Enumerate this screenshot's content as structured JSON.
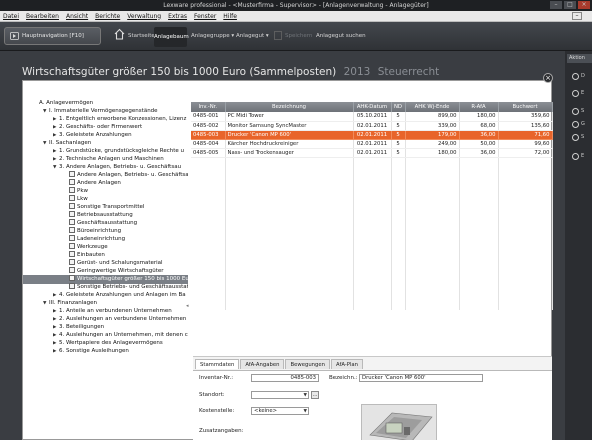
{
  "window": {
    "title": "Lexware professional - <Musterfirma - Supervisor> - [Anlagenverwaltung - Anlagegüter]",
    "controls": [
      "–",
      "□",
      "×"
    ]
  },
  "menu": [
    "Datei",
    "Bearbeiten",
    "Ansicht",
    "Berichte",
    "Verwaltung",
    "Extras",
    "Fenster",
    "Hilfe"
  ],
  "menu_min": "–",
  "toolbar": {
    "hauptnavigation": "Hauptnavigation [F10]",
    "startseite": "Startseite",
    "anlagebaum": "Anlagebaum",
    "anlagegruppe": "Anlagegruppe",
    "anlagegut": "Anlagegut",
    "speichern": "Speichern",
    "anlagegut_suchen": "Anlagegut suchen"
  },
  "page": {
    "title": "Wirtschaftsgüter größer 150 bis 1000 Euro (Sammelposten)",
    "year": "2013",
    "law": "Steuerrecht"
  },
  "tree": [
    {
      "label": "A. Anlagevermögen",
      "level": 0,
      "arrow": ""
    },
    {
      "label": "I. Immaterielle Vermögensgegenstände",
      "level": 1,
      "arrow": "▼"
    },
    {
      "label": "1. Entgeltlich erworbene Konzessionen, Lizenz",
      "level": 2,
      "arrow": "▶"
    },
    {
      "label": "2. Geschäfts- oder Firmenwert",
      "level": 2,
      "arrow": "▶"
    },
    {
      "label": "3. Geleistete Anzahlungen",
      "level": 2,
      "arrow": "▶"
    },
    {
      "label": "II. Sachanlagen",
      "level": 1,
      "arrow": "▼"
    },
    {
      "label": "1. Grundstücke, grundstücksgleiche Rechte u",
      "level": 2,
      "arrow": "▶"
    },
    {
      "label": "2. Technische Anlagen und Maschinen",
      "level": 2,
      "arrow": "▶"
    },
    {
      "label": "3. Andere Anlagen, Betriebs- u. Geschäftsau",
      "level": 2,
      "arrow": "▼"
    },
    {
      "label": "Andere Anlagen, Betriebs- u. Geschäftsau",
      "level": 3,
      "arrow": ""
    },
    {
      "label": "Andere Anlagen",
      "level": 3,
      "arrow": ""
    },
    {
      "label": "Pkw",
      "level": 3,
      "arrow": ""
    },
    {
      "label": "Lkw",
      "level": 3,
      "arrow": ""
    },
    {
      "label": "Sonstige Transportmittel",
      "level": 3,
      "arrow": ""
    },
    {
      "label": "Betriebsausstattung",
      "level": 3,
      "arrow": ""
    },
    {
      "label": "Geschäftsausstattung",
      "level": 3,
      "arrow": ""
    },
    {
      "label": "Büroeinrichtung",
      "level": 3,
      "arrow": ""
    },
    {
      "label": "Ladeneinrichtung",
      "level": 3,
      "arrow": ""
    },
    {
      "label": "Werkzeuge",
      "level": 3,
      "arrow": ""
    },
    {
      "label": "Einbauten",
      "level": 3,
      "arrow": ""
    },
    {
      "label": "Gerüst- und Schalungsmaterial",
      "level": 3,
      "arrow": ""
    },
    {
      "label": "Geringwertige Wirtschaftsgüter",
      "level": 3,
      "arrow": ""
    },
    {
      "label": "Wirtschaftsgüter größer 150 bis 1000 Euro",
      "level": 3,
      "arrow": "",
      "selected": true
    },
    {
      "label": "Sonstige Betriebs- und Geschäftsausstatt",
      "level": 3,
      "arrow": ""
    },
    {
      "label": "4. Geleistete Anzahlungen und Anlagen im Ba",
      "level": 2,
      "arrow": "▶"
    },
    {
      "label": "III. Finanzanlagen",
      "level": 1,
      "arrow": "▼"
    },
    {
      "label": "1. Anteile an verbundenen Unternehmen",
      "level": 2,
      "arrow": "▶"
    },
    {
      "label": "2. Ausleihungen an verbundene Unternehmen",
      "level": 2,
      "arrow": "▶"
    },
    {
      "label": "3. Beteiligungen",
      "level": 2,
      "arrow": "▶"
    },
    {
      "label": "4. Ausleihungen an Unternehmen, mit denen c",
      "level": 2,
      "arrow": "▶"
    },
    {
      "label": "5. Wertpapiere des Anlagevermögens",
      "level": 2,
      "arrow": "▶"
    },
    {
      "label": "6. Sonstige Ausleihungen",
      "level": 2,
      "arrow": "▶"
    }
  ],
  "tree_scroll_arrow": "◂",
  "grid": {
    "columns": [
      "Inv.-Nr.",
      "Bezeichnung",
      "AHK-Datum",
      "ND",
      "AHK Wj-Ende",
      "R-AfA",
      "Buchwert"
    ],
    "rows": [
      [
        "0485-001",
        "PC Midi Tower",
        "05.10.2011",
        "5",
        "899,00",
        "180,00",
        "359,60"
      ],
      [
        "0485-002",
        "Monitor Samsung SyncMaster",
        "02.01.2011",
        "5",
        "339,00",
        "68,00",
        "135,60"
      ],
      [
        "0485-003",
        "Drucker 'Canon MP 600'",
        "02.01.2011",
        "5",
        "179,00",
        "36,00",
        "71,60"
      ],
      [
        "0485-004",
        "Kärcher Hochdruckreiniger",
        "02.01.2011",
        "5",
        "249,00",
        "50,00",
        "99,60"
      ],
      [
        "0485-005",
        "Nass- und Trockensauger",
        "02.01.2011",
        "5",
        "180,00",
        "36,00",
        "72,00"
      ]
    ],
    "highlighted_row": 2
  },
  "detail": {
    "tabs": [
      "Stammdaten",
      "AfA-Angaben",
      "Bewegungen",
      "AfA-Plan"
    ],
    "active_tab": "Stammdaten",
    "inventar_label": "Inventar-Nr.:",
    "inventar_value": "0485-003",
    "bezeichnung_label": "Bezeichn.:",
    "bezeichnung_value": "Drucker 'Canon MP 600'",
    "standort_label": "Standort:",
    "standort_value": "",
    "kostenstelle_label": "Kostenstelle:",
    "kostenstelle_value": "<keine>",
    "zusatzangaben_label": "Zusatzangaben:",
    "dropdown_arrow": "▼",
    "browse_label": "..."
  },
  "right_panel": {
    "tab_label": "Aktion",
    "items": [
      "D",
      "E",
      "S",
      "G",
      "S",
      "E"
    ]
  },
  "colors": {
    "highlight": "#e8642a",
    "dark_bg": "#3a3d42",
    "toolbar": "#3d4045"
  }
}
